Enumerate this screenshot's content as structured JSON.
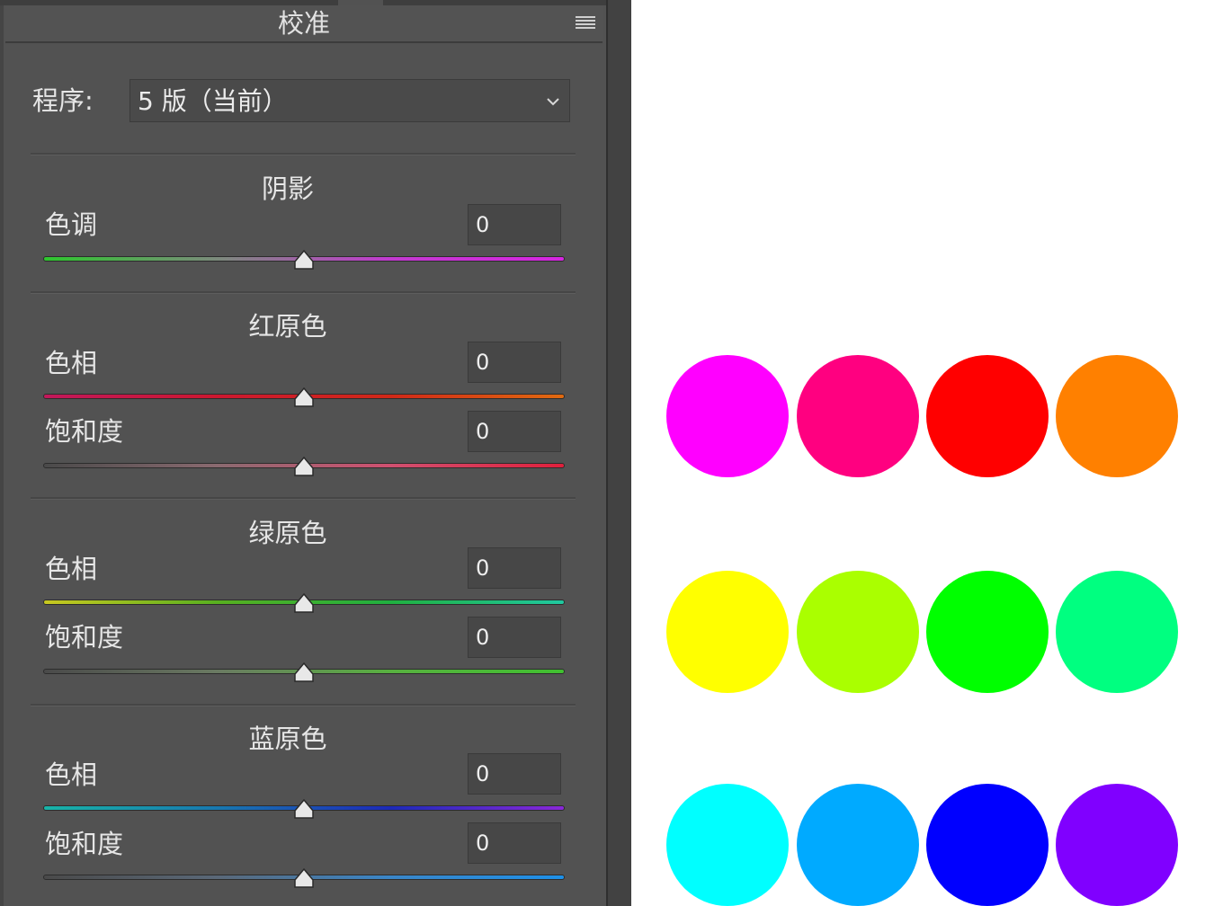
{
  "panel": {
    "title": "校准",
    "process": {
      "label": "程序:",
      "value": "5 版（当前）"
    },
    "sections": [
      {
        "title": "阴影",
        "rows": [
          {
            "label": "色调",
            "value": "0",
            "gradient": [
              "#2ec62e",
              "#7c8a7c",
              "#c23ad0",
              "#d626e0"
            ]
          }
        ]
      },
      {
        "title": "红原色",
        "rows": [
          {
            "label": "色相",
            "value": "0",
            "gradient": [
              "#c2185b",
              "#cc1830",
              "#d02818",
              "#e06a10"
            ]
          },
          {
            "label": "饱和度",
            "value": "0",
            "gradient": [
              "#4a4a4a",
              "#8a6a70",
              "#d05070",
              "#e0203c"
            ]
          }
        ]
      },
      {
        "title": "绿原色",
        "rows": [
          {
            "label": "色相",
            "value": "0",
            "gradient": [
              "#c8c820",
              "#58b020",
              "#20b040",
              "#20c8a0"
            ]
          },
          {
            "label": "饱和度",
            "value": "0",
            "gradient": [
              "#4a4a4a",
              "#6a7a62",
              "#58b040",
              "#40c030"
            ]
          }
        ]
      },
      {
        "title": "蓝原色",
        "rows": [
          {
            "label": "色相",
            "value": "0",
            "gradient": [
              "#18b4a8",
              "#1878b0",
              "#1c2ab8",
              "#8a28d8"
            ]
          },
          {
            "label": "饱和度",
            "value": "0",
            "gradient": [
              "#4a4a4a",
              "#5a6878",
              "#3a86c8",
              "#1e90e8"
            ]
          }
        ]
      }
    ]
  },
  "swatches": [
    [
      "#ff00ff",
      "#ff0080",
      "#ff0000",
      "#ff8000"
    ],
    [
      "#ffff00",
      "#aaff00",
      "#00ff00",
      "#00ff80"
    ],
    [
      "#00ffff",
      "#00aaff",
      "#0000ff",
      "#8000ff"
    ]
  ]
}
